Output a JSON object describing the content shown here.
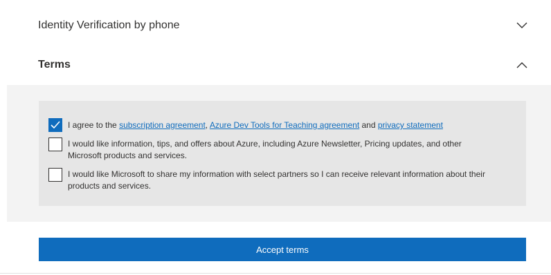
{
  "sections": {
    "identity": {
      "title": "Identity Verification by phone",
      "expanded": false,
      "icon": "chevron-down-icon"
    },
    "terms": {
      "title": "Terms",
      "expanded": true,
      "icon": "chevron-up-icon"
    }
  },
  "terms": {
    "agree": {
      "checked": true,
      "prefix": "I agree to the ",
      "link1": "subscription agreement",
      "sep1": ", ",
      "link2": "Azure Dev Tools for Teaching agreement",
      "sep2": " and ",
      "link3": "privacy statement"
    },
    "offers": {
      "checked": false,
      "text": "I would like information, tips, and offers about Azure, including Azure Newsletter, Pricing updates, and other Microsoft products and services."
    },
    "share": {
      "checked": false,
      "text": "I would like Microsoft to share my information with select partners so I can receive relevant information about their products and services."
    }
  },
  "accept_button": {
    "label": "Accept terms"
  },
  "colors": {
    "accent": "#0f6cbd",
    "panel": "#f3f3f3",
    "box": "#e6e6e6"
  }
}
